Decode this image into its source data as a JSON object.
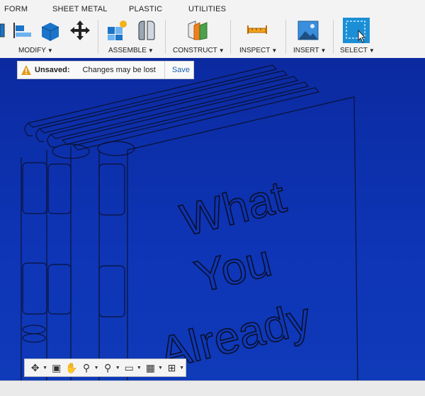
{
  "toolbar": {
    "tabs": [
      "FORM",
      "SHEET METAL",
      "PLASTIC",
      "UTILITIES"
    ],
    "groups": [
      "MODIFY",
      "ASSEMBLE",
      "CONSTRUCT",
      "INSPECT",
      "INSERT",
      "SELECT"
    ]
  },
  "unsaved": {
    "title": "Unsaved:",
    "message": "Changes may be lost",
    "save": "Save"
  },
  "model": {
    "words": [
      "What",
      "You",
      "Already"
    ]
  },
  "colors": {
    "canvas": "#0b2fa6",
    "accent": "#1a5fb4",
    "warning": "#e39b1b"
  }
}
